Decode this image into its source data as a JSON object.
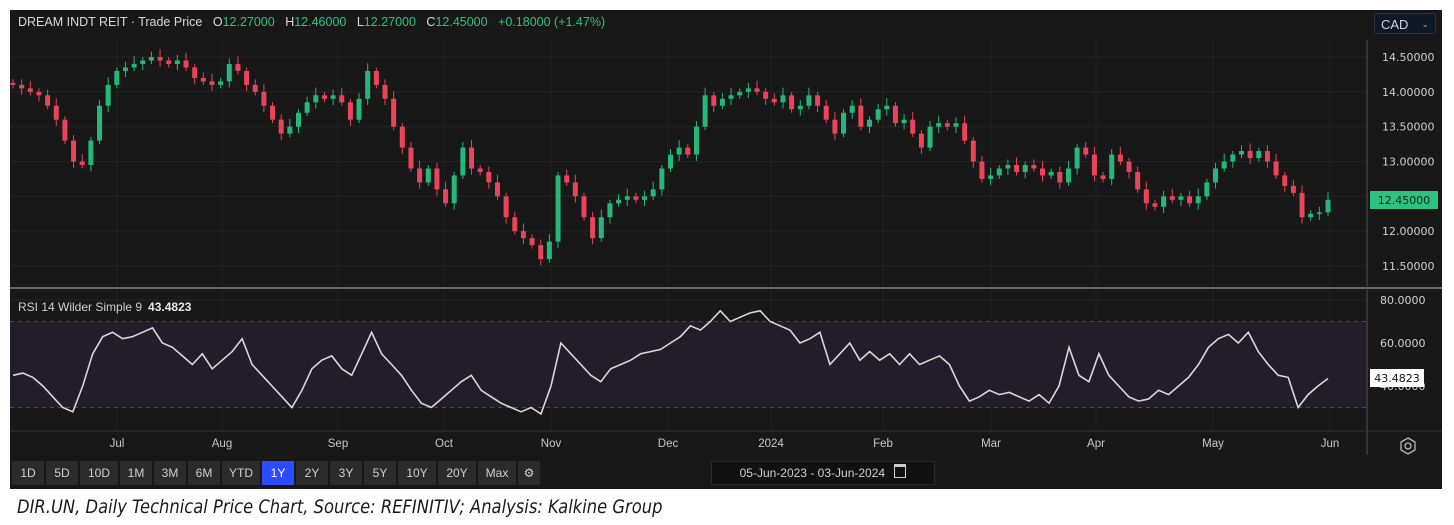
{
  "header": {
    "instrument": "DREAM INDT REIT",
    "separator": "·",
    "series_type": "Trade Price",
    "o_label": "O",
    "open": "12.27000",
    "h_label": "H",
    "high": "12.46000",
    "l_label": "L",
    "low": "12.27000",
    "c_label": "C",
    "close": "12.45000",
    "change": "+0.18000 (+1.47%)"
  },
  "currency": {
    "value": "CAD",
    "chevron": "⌄"
  },
  "rsi_header": {
    "label": "RSI 14 Wilder Simple 9",
    "value": "43.4823"
  },
  "price_axis": {
    "ticks": [
      "14.50000",
      "14.00000",
      "13.50000",
      "13.00000",
      "12.00000",
      "11.50000"
    ],
    "last_price": "12.45000"
  },
  "rsi_axis": {
    "ticks": [
      "80.0000",
      "60.0000",
      "40.0000"
    ],
    "last_value": "43.4823"
  },
  "time_axis": [
    "Jul",
    "Aug",
    "Sep",
    "Oct",
    "Nov",
    "Dec",
    "2024",
    "Feb",
    "Mar",
    "Apr",
    "May",
    "Jun"
  ],
  "range_buttons": [
    "1D",
    "5D",
    "10D",
    "1M",
    "3M",
    "6M",
    "YTD",
    "1Y",
    "2Y",
    "3Y",
    "5Y",
    "10Y",
    "20Y",
    "Max"
  ],
  "active_range": "1Y",
  "date_range": {
    "from": "05-Jun-2023",
    "sep": "-",
    "to": "03-Jun-2024"
  },
  "caption": "DIR.UN, Daily Technical Price Chart, Source: REFINITIV; Analysis: Kalkine Group",
  "colors": {
    "up": "#26b77a",
    "down": "#e8445a",
    "background": "#181818",
    "rsi_line": "#d8d8d8",
    "rsi_band": "#221d2b",
    "last_price_bg": "#2fc27f"
  },
  "chart_data": [
    {
      "type": "candlestick",
      "title": "DREAM INDT REIT - Trade Price",
      "ylim": [
        11.3,
        14.8
      ],
      "x_start": "05-Jun-2023",
      "x_end": "03-Jun-2024",
      "closes": [
        14.1,
        14.05,
        14.0,
        13.95,
        13.8,
        13.6,
        13.3,
        13.0,
        12.95,
        13.3,
        13.8,
        14.1,
        14.3,
        14.35,
        14.4,
        14.45,
        14.5,
        14.45,
        14.4,
        14.45,
        14.35,
        14.2,
        14.15,
        14.1,
        14.15,
        14.4,
        14.3,
        14.1,
        14.0,
        13.8,
        13.6,
        13.4,
        13.5,
        13.7,
        13.85,
        13.95,
        13.9,
        13.95,
        13.85,
        13.6,
        13.9,
        14.3,
        14.1,
        13.9,
        13.5,
        13.2,
        12.9,
        12.7,
        12.9,
        12.6,
        12.4,
        12.8,
        13.2,
        12.9,
        12.85,
        12.7,
        12.5,
        12.2,
        12.0,
        11.9,
        11.8,
        11.6,
        11.85,
        12.8,
        12.7,
        12.5,
        12.2,
        11.9,
        12.2,
        12.4,
        12.45,
        12.5,
        12.45,
        12.5,
        12.6,
        12.9,
        13.1,
        13.2,
        13.1,
        13.5,
        13.95,
        13.8,
        13.9,
        13.95,
        14.0,
        14.05,
        14.0,
        13.9,
        13.85,
        13.95,
        13.75,
        13.8,
        13.95,
        13.8,
        13.6,
        13.4,
        13.7,
        13.8,
        13.5,
        13.6,
        13.75,
        13.8,
        13.55,
        13.6,
        13.4,
        13.2,
        13.5,
        13.55,
        13.5,
        13.55,
        13.3,
        13.0,
        12.75,
        12.8,
        12.9,
        12.95,
        12.85,
        12.95,
        12.9,
        12.8,
        12.85,
        12.7,
        12.9,
        13.2,
        13.1,
        12.8,
        12.75,
        13.1,
        13.0,
        12.85,
        12.6,
        12.4,
        12.35,
        12.5,
        12.45,
        12.5,
        12.4,
        12.5,
        12.7,
        12.9,
        13.0,
        13.1,
        13.15,
        13.05,
        13.15,
        13.0,
        12.8,
        12.65,
        12.55,
        12.2,
        12.25,
        12.27,
        12.45
      ]
    },
    {
      "type": "line",
      "title": "RSI 14 Wilder Simple 9",
      "ylim": [
        20,
        85
      ],
      "bands": [
        30,
        70
      ],
      "values": [
        45,
        46,
        44,
        40,
        35,
        30,
        28,
        40,
        55,
        63,
        65,
        62,
        63,
        65,
        67,
        60,
        58,
        54,
        50,
        55,
        48,
        52,
        56,
        62,
        50,
        45,
        40,
        35,
        30,
        38,
        48,
        52,
        54,
        48,
        45,
        55,
        65,
        55,
        50,
        45,
        38,
        32,
        30,
        34,
        38,
        42,
        45,
        38,
        35,
        32,
        30,
        28,
        30,
        27,
        40,
        60,
        55,
        50,
        45,
        42,
        48,
        50,
        52,
        55,
        56,
        57,
        60,
        63,
        68,
        66,
        70,
        75,
        70,
        72,
        74,
        75,
        70,
        68,
        66,
        60,
        62,
        65,
        50,
        55,
        60,
        52,
        56,
        52,
        55,
        50,
        55,
        50,
        52,
        54,
        50,
        40,
        33,
        35,
        38,
        36,
        37,
        35,
        33,
        36,
        32,
        40,
        58,
        45,
        42,
        55,
        45,
        40,
        35,
        33,
        34,
        38,
        36,
        40,
        44,
        50,
        58,
        62,
        64,
        60,
        65,
        56,
        50,
        45,
        44,
        30,
        36,
        40,
        43.5
      ]
    }
  ]
}
